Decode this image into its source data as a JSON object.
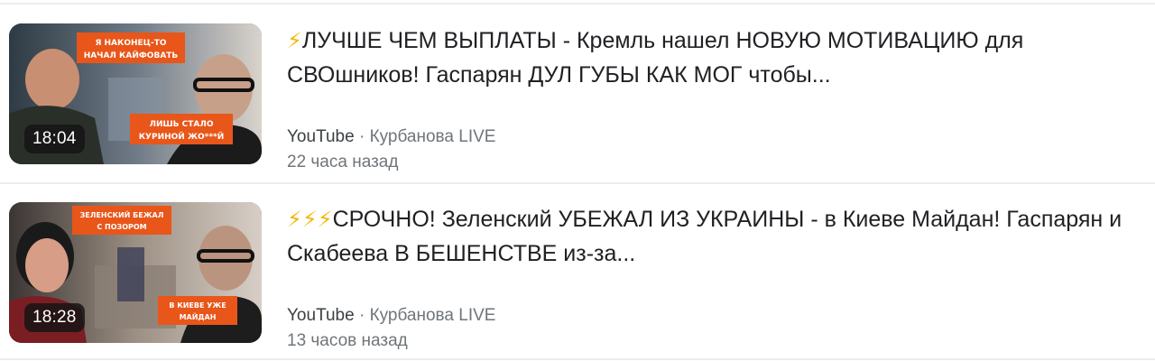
{
  "results": [
    {
      "bolts": "⚡",
      "title": "ЛУЧШЕ ЧЕМ ВЫПЛАТЫ - Кремль нашел НОВУЮ МОТИВАЦИЮ для СВОшников! Гаспарян ДУЛ ГУБЫ КАК МОГ чтобы...",
      "duration": "18:04",
      "platform": "YouTube",
      "separator": " · ",
      "channel": "Курбанова LIVE",
      "time_ago": "22 часа назад",
      "thumb_caption_top_1": "Я НАКОНЕЦ-ТО",
      "thumb_caption_top_2": "НАЧАЛ КАЙФОВАТЬ",
      "thumb_caption_bottom_1": "ЛИШЬ СТАЛО",
      "thumb_caption_bottom_2": "КУРИНОЙ ЖО***Й"
    },
    {
      "bolts": "⚡⚡⚡",
      "title": "СРОЧНО! Зеленский УБЕЖАЛ ИЗ УКРАИНЫ - в Киеве Майдан! Гаспарян и Скабеева В БЕШЕНСТВЕ из-за...",
      "duration": "18:28",
      "platform": "YouTube",
      "separator": " · ",
      "channel": "Курбанова LIVE",
      "time_ago": "13 часов назад",
      "thumb_caption_top_1": "ЗЕЛЕНСКИЙ БЕЖАЛ",
      "thumb_caption_top_2": "С ПОЗОРОМ",
      "thumb_caption_bottom_1": "В КИЕВЕ УЖЕ",
      "thumb_caption_bottom_2": "МАЙДАН"
    }
  ],
  "colors": {
    "title": "#202124",
    "meta": "#70757a",
    "bolt": "#f2b705",
    "separator": "#ececec",
    "caption_bg": "#e8561a"
  }
}
